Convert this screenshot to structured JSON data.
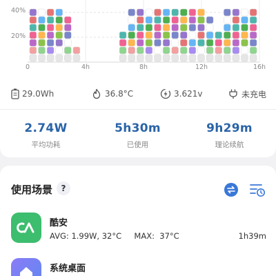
{
  "chart_data": {
    "type": "bar",
    "title": "",
    "xlabel": "",
    "ylabel": "",
    "y_ticks": [
      "40%",
      "20%"
    ],
    "x_ticks": [
      "0",
      "4h",
      "8h",
      "12h",
      "16h"
    ],
    "ylim": [
      0,
      50
    ],
    "xlim": [
      0,
      16
    ],
    "description_of_marks": "stacked app-icon blocks per time slot",
    "x": [
      0.4,
      1.0,
      1.6,
      2.2,
      2.8,
      3.4,
      4.0,
      4.6,
      5.2,
      6.6,
      7.2,
      7.8,
      8.4,
      9.0,
      9.6,
      10.2,
      10.8,
      11.4,
      12.0,
      12.6,
      13.2,
      13.8,
      14.4,
      15.0,
      15.6
    ],
    "values": [
      46,
      46,
      46,
      42,
      40,
      12,
      4,
      4,
      4,
      24,
      44,
      46,
      42,
      46,
      44,
      46,
      46,
      44,
      46,
      40,
      24,
      46,
      44,
      42,
      46
    ]
  },
  "power_stats": {
    "energy": "29.0Wh",
    "temperature": "36.8°C",
    "voltage": "3.621v",
    "charge_status": "未充电"
  },
  "metrics": [
    {
      "value": "2.74W",
      "label": "平均功耗"
    },
    {
      "value": "5h30m",
      "label": "已使用"
    },
    {
      "value": "9h29m",
      "label": "理论续航"
    }
  ],
  "section": {
    "title": "使用场景",
    "help": "?"
  },
  "apps": [
    {
      "name": "酷安",
      "detail": "AVG: 1.99W, 32°C     MAX:  37°C",
      "time": "1h39m",
      "color": "#3dbd6e",
      "icon": "coolapk-icon"
    },
    {
      "name": "系统桌面",
      "detail": "",
      "time": "",
      "color": "#7b6cf0",
      "icon": "home-icon"
    }
  ],
  "colors": {
    "accent": "#2a64a8",
    "tool_icon": "#3a78d8"
  }
}
